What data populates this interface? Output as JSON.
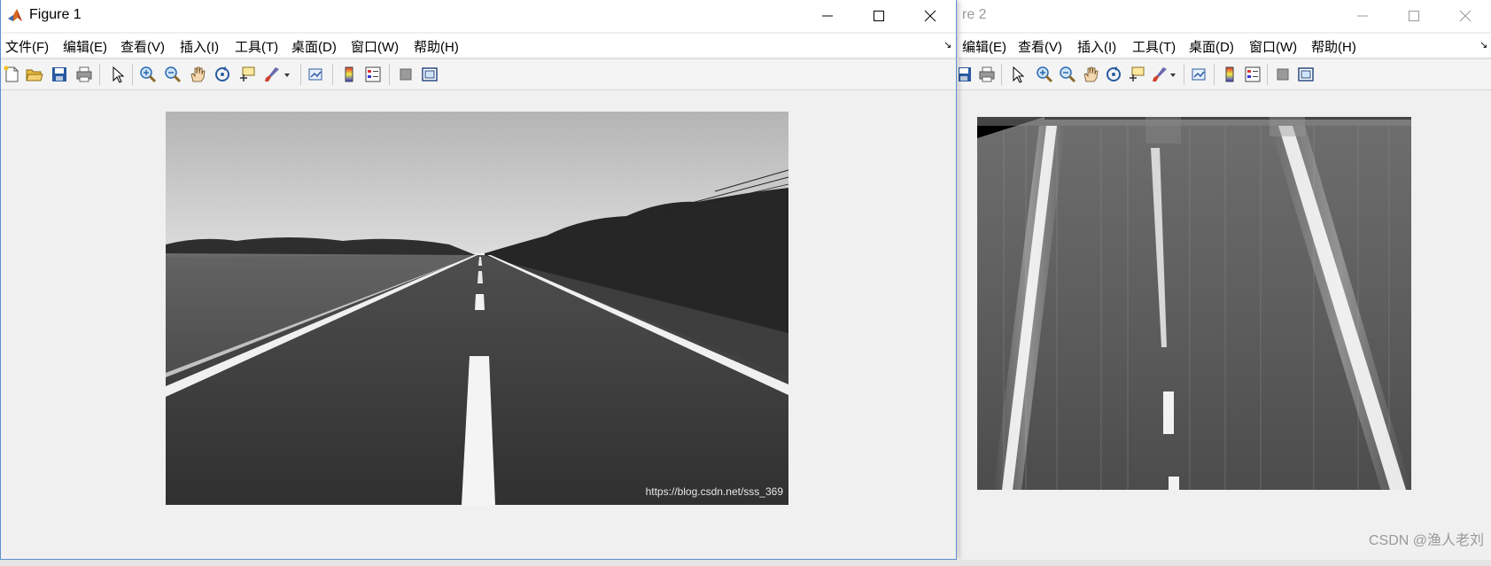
{
  "figure2": {
    "title_fragment": "re 2",
    "menu": [
      "编辑(E)",
      "查看(V)",
      "插入(I)",
      "工具(T)",
      "桌面(D)",
      "窗口(W)",
      "帮助(H)"
    ]
  },
  "figure1": {
    "title": "Figure 1",
    "menu": [
      "文件(F)",
      "编辑(E)",
      "查看(V)",
      "插入(I)",
      "工具(T)",
      "桌面(D)",
      "窗口(W)",
      "帮助(H)"
    ],
    "image_caption": "https://blog.csdn.net/sss_369"
  },
  "watermark": "CSDN @渔人老刘",
  "icons": {
    "toolbar": [
      "new-figure-icon",
      "open-file-icon",
      "save-icon",
      "print-icon",
      "select-arrow-icon",
      "zoom-in-icon",
      "zoom-out-icon",
      "pan-hand-icon",
      "rotate-3d-icon",
      "data-cursor-icon",
      "brush-icon",
      "brush-dropdown-icon",
      "link-plot-icon",
      "insert-colorbar-icon",
      "insert-legend-icon",
      "hide-plot-tools-icon",
      "show-plot-tools-icon"
    ],
    "window": [
      "minimize-icon",
      "maximize-icon",
      "close-icon"
    ]
  }
}
